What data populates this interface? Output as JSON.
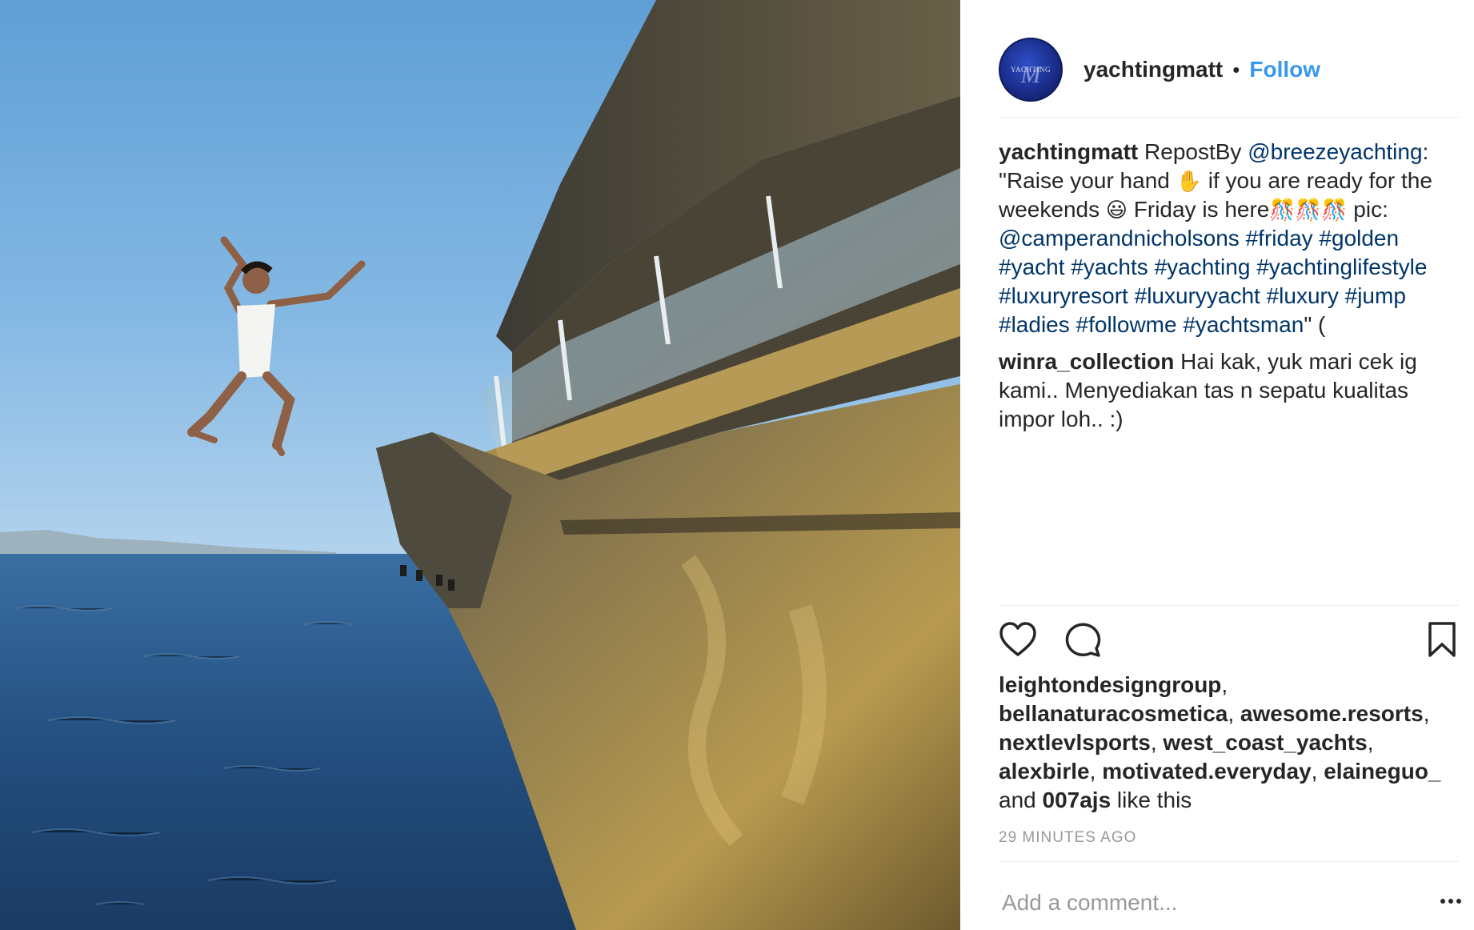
{
  "post": {
    "username": "yachtingmatt",
    "separator": "•",
    "follow_label": "Follow",
    "avatar_text": "YACHTING",
    "avatar_letter": "M",
    "caption": {
      "author": "yachtingmatt",
      "t1": " RepostBy ",
      "mention1": "@breezeyachting",
      "t2": ": \"Raise your hand ",
      "t3": " if you are ready for the weekends ",
      "t4": " Friday is here",
      "t5": " pic: ",
      "mention2": "@camperandnicholsons",
      "hashtags": [
        "#friday",
        "#golden",
        "#yacht",
        "#yachts",
        "#yachting",
        "#yachtinglifestyle",
        "#luxuryresort",
        "#luxuryyacht",
        "#luxury",
        "#jump",
        "#ladies",
        "#followme",
        "#yachtsman"
      ],
      "t6": "\" (",
      "emoji_hand": "✋",
      "emoji_smile": "😃",
      "emoji_party": "🎊"
    },
    "comment": {
      "author": "winra_collection",
      "text": " Hai kak, yuk mari cek ig kami.. Menyediakan tas n sepatu kualitas impor loh.. :)"
    },
    "likes": {
      "users": [
        "leightondesigngroup",
        "bellanaturacosmetica",
        "awesome.resorts",
        "nextlevlsports",
        "west_coast_yachts",
        "alexbirle",
        "motivated.everyday",
        "elaineguo_"
      ],
      "and_label": "and",
      "last_user": "007ajs",
      "suffix": "like this"
    },
    "timestamp": "29 MINUTES AGO",
    "add_comment_placeholder": "Add a comment...",
    "icons": [
      "heart-icon",
      "comment-icon",
      "bookmark-icon",
      "more-options-icon"
    ]
  }
}
